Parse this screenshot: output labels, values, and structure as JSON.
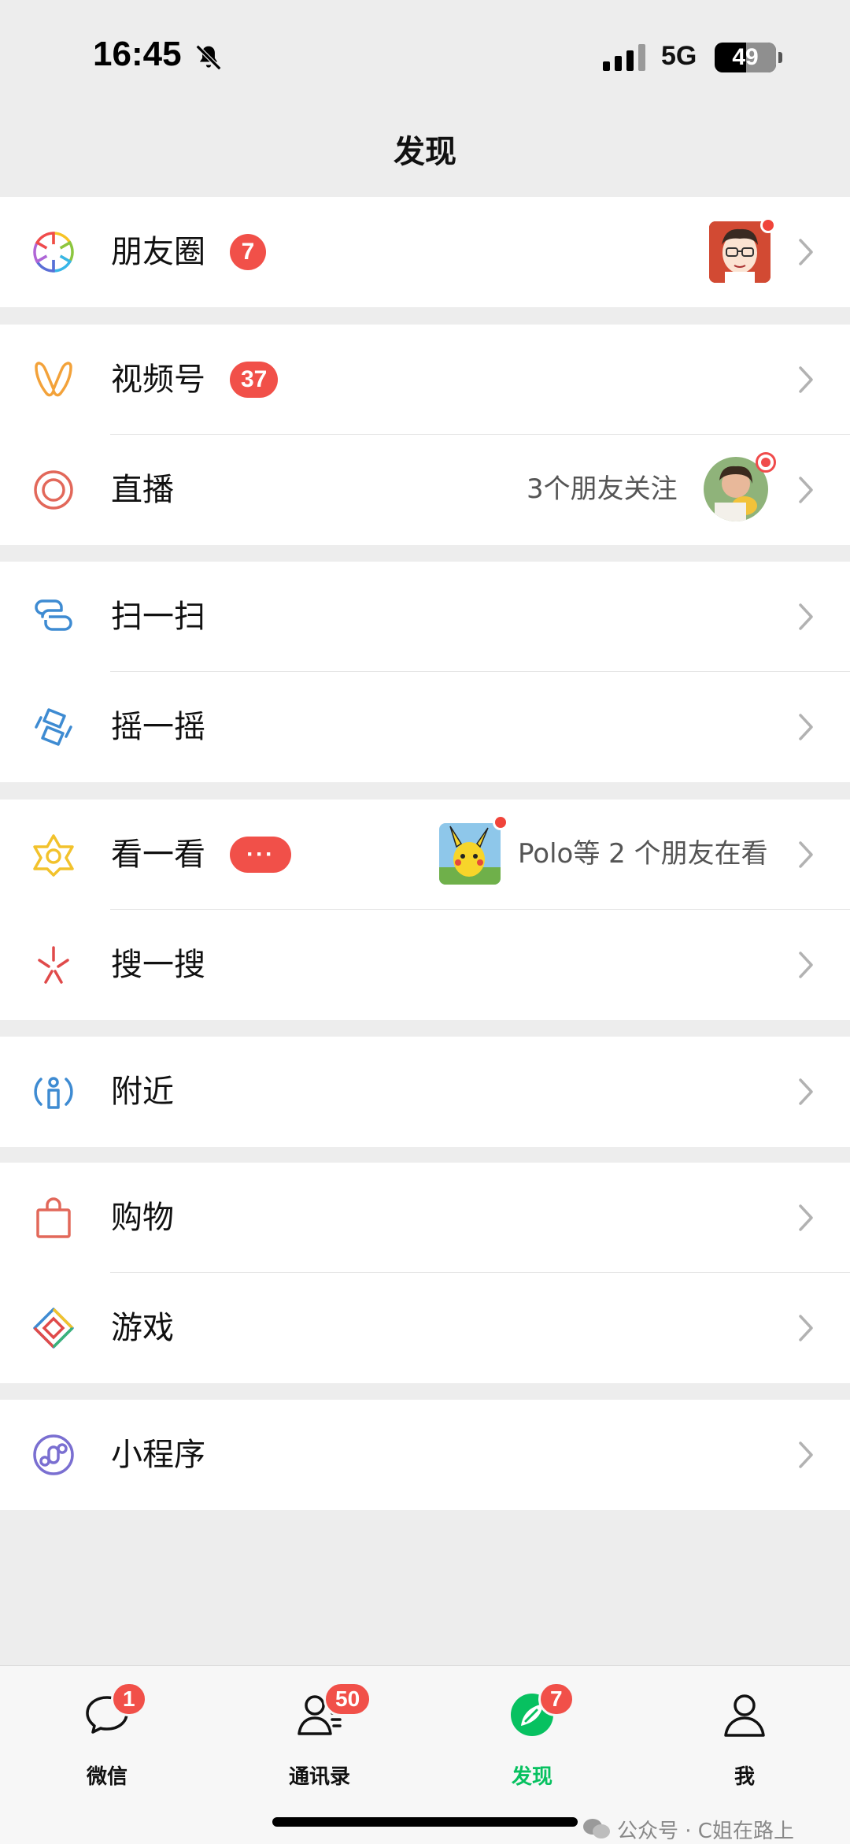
{
  "status_bar": {
    "time": "16:45",
    "network": "5G",
    "battery": "49"
  },
  "title": "发现",
  "groups": [
    {
      "items": [
        {
          "label": "朋友圈",
          "badge": "7",
          "icon": "moments-icon"
        }
      ]
    },
    {
      "items": [
        {
          "label": "视频号",
          "badge": "37",
          "icon": "channels-icon"
        },
        {
          "label": "直播",
          "right_text": "3个朋友关注",
          "icon": "live-icon"
        }
      ]
    },
    {
      "items": [
        {
          "label": "扫一扫",
          "icon": "scan-icon"
        },
        {
          "label": "摇一摇",
          "icon": "shake-icon"
        }
      ]
    },
    {
      "items": [
        {
          "label": "看一看",
          "badge": "···",
          "right_text": "Polo等 2 个朋友在看",
          "icon": "top-stories-icon"
        },
        {
          "label": "搜一搜",
          "icon": "search-icon"
        }
      ]
    },
    {
      "items": [
        {
          "label": "附近",
          "icon": "nearby-icon"
        }
      ]
    },
    {
      "items": [
        {
          "label": "购物",
          "icon": "shopping-bag-icon"
        },
        {
          "label": "游戏",
          "icon": "games-icon"
        }
      ]
    },
    {
      "items": [
        {
          "label": "小程序",
          "icon": "mini-programs-icon"
        }
      ]
    }
  ],
  "tabs": [
    {
      "label": "微信",
      "badge": "1",
      "icon": "chat-bubble-icon"
    },
    {
      "label": "通讯录",
      "badge": "50",
      "icon": "contacts-icon"
    },
    {
      "label": "发现",
      "badge": "7",
      "icon": "discover-compass-icon",
      "active": true
    },
    {
      "label": "我",
      "icon": "me-person-icon"
    }
  ],
  "watermark": "公众号 · C姐在路上",
  "colors": {
    "accent": "#07c160",
    "badge": "#f15049",
    "background": "#ededed"
  }
}
